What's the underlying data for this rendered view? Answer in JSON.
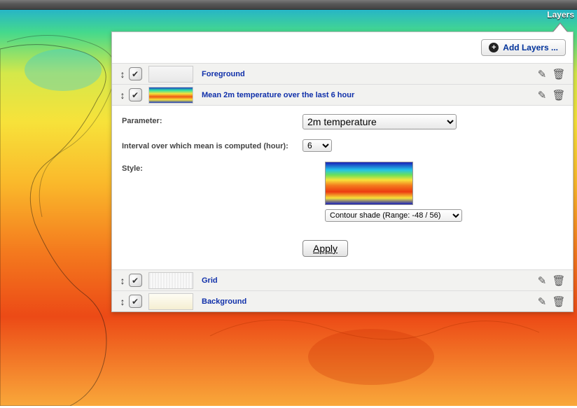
{
  "header": {
    "tab": "Layers"
  },
  "toolbar": {
    "add_label": "Add Layers ..."
  },
  "layers": [
    {
      "name": "Foreground"
    },
    {
      "name": "Mean 2m temperature over the last 6 hour"
    },
    {
      "name": "Grid"
    },
    {
      "name": "Background"
    }
  ],
  "details": {
    "parameter_label": "Parameter:",
    "parameter_value": "2m temperature",
    "interval_label": "Interval over which mean is computed (hour):",
    "interval_value": "6",
    "style_label": "Style:",
    "style_value": "Contour shade (Range: -48 / 56)",
    "apply_label": "Apply"
  }
}
